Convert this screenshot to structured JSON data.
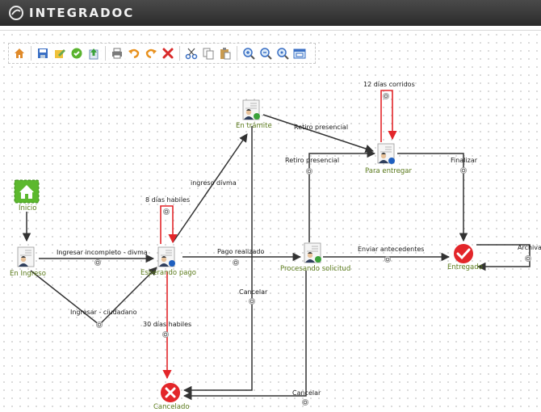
{
  "app": {
    "title": "INTEGRADOC"
  },
  "toolbar": {
    "buttons": [
      {
        "name": "home-icon"
      },
      {
        "name": "save-icon"
      },
      {
        "name": "edit-icon"
      },
      {
        "name": "check-icon"
      },
      {
        "name": "upload-icon"
      },
      {
        "name": "print-icon"
      },
      {
        "name": "undo-icon"
      },
      {
        "name": "redo-icon"
      },
      {
        "name": "delete-icon"
      },
      {
        "name": "cut-icon"
      },
      {
        "name": "copy-icon"
      },
      {
        "name": "paste-icon"
      },
      {
        "name": "zoom-in-icon"
      },
      {
        "name": "zoom-out-icon"
      },
      {
        "name": "zoom-actual-icon"
      },
      {
        "name": "fit-window-icon"
      }
    ]
  },
  "nodes": {
    "inicio": "Inicio",
    "en_ingreso": "En Ingreso",
    "esperando_pago": "Esperando pago",
    "en_tramite": "En trámite",
    "procesando_solicitud": "Procesando solicitud",
    "para_entregar": "Para entregar",
    "entregado": "Entregado",
    "cancelado": "Cancelado"
  },
  "edges": {
    "ingresar_incompleto": "Ingresar incompleto - divma",
    "ingresar_ciudadano": "Ingresar - ciudadano",
    "ocho_dias": "8 días habiles",
    "ingreso_divma": "ingreso divma",
    "pago_realizado": "Pago realizado",
    "retiro_presencial_1": "Retiro presencial",
    "retiro_presencial_2": "Retiro presencial",
    "doce_dias": "12 días corridos",
    "finalizar": "Finalizar",
    "enviar_antecedentes": "Enviar antecedentes",
    "archivar": "Archivar",
    "cancelar_1": "Cancelar",
    "cancelar_2": "Cancelar",
    "treinta_dias": "30 días habiles"
  },
  "colors": {
    "header": "#333333",
    "normal_edge": "#333333",
    "timer_edge": "#e3262a",
    "node_label": "#5a7a1a",
    "start_green": "#5cb82e",
    "end_red": "#e3262a"
  }
}
